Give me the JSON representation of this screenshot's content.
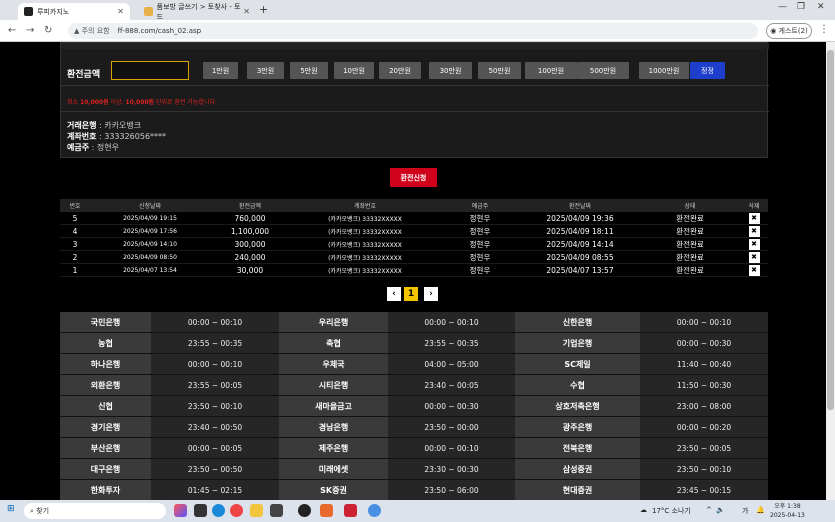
{
  "browser": {
    "tabs": [
      {
        "title": "루피카지노",
        "active": true
      },
      {
        "title": "품보방 글쓰기 > 토찾사 - 토드",
        "active": false
      }
    ],
    "security_label": "주의 요함",
    "url": "ff-888.com/cash_02.asp",
    "guest_label": "게스트(2)"
  },
  "exchange": {
    "amount_label": "환전금액",
    "amount_value": "",
    "amount_buttons": [
      "1만원",
      "3만원",
      "5만원",
      "10만원",
      "20만원",
      "30만원",
      "50만원",
      "100만원",
      "500만원",
      "1000만원"
    ],
    "reset_label": "정정",
    "notice_prefix": "최소 ",
    "notice_min": "10,000원",
    "notice_mid": " 이상, ",
    "notice_unit": "10,000원",
    "notice_suffix": " 단위로 환전 가능합니다.",
    "bank_label": "거래은행",
    "bank_value": "카카오뱅크",
    "account_label": "계좌번호",
    "account_value": "333326056****",
    "holder_label": "예금주",
    "holder_value": "정현우",
    "apply_label": "환전신청"
  },
  "history": {
    "headers": [
      "번호",
      "신청날짜",
      "환전금액",
      "계좌번호",
      "예금주",
      "환전날짜",
      "상태",
      "삭제"
    ],
    "rows": [
      {
        "no": "5",
        "req": "2025/04/09 19:15",
        "amount": "760,000",
        "account": "(카카오뱅크) 33332XXXXX",
        "holder": "정현우",
        "done": "2025/04/09 19:36",
        "status": "환전완료"
      },
      {
        "no": "4",
        "req": "2025/04/09 17:56",
        "amount": "1,100,000",
        "account": "(카카오뱅크) 33332XXXXX",
        "holder": "정현우",
        "done": "2025/04/09 18:11",
        "status": "환전완료"
      },
      {
        "no": "3",
        "req": "2025/04/09 14:10",
        "amount": "300,000",
        "account": "(카카오뱅크) 33332XXXXX",
        "holder": "정현우",
        "done": "2025/04/09 14:14",
        "status": "환전완료"
      },
      {
        "no": "2",
        "req": "2025/04/09 08:50",
        "amount": "240,000",
        "account": "(카카오뱅크) 33332XXXXX",
        "holder": "정현우",
        "done": "2025/04/09 08:55",
        "status": "환전완료"
      },
      {
        "no": "1",
        "req": "2025/04/07 13:54",
        "amount": "30,000",
        "account": "(카카오뱅크) 33332XXXXX",
        "holder": "정현우",
        "done": "2025/04/07 13:57",
        "status": "환전완료"
      }
    ],
    "page": "1"
  },
  "banks": [
    [
      {
        "name": "국민은행",
        "time": "00:00 ~ 00:10"
      },
      {
        "name": "우리은행",
        "time": "00:00 ~ 00:10"
      },
      {
        "name": "신한은행",
        "time": "00:00 ~ 00:10"
      }
    ],
    [
      {
        "name": "농협",
        "time": "23:55 ~ 00:35"
      },
      {
        "name": "축협",
        "time": "23:55 ~ 00:35"
      },
      {
        "name": "기업은행",
        "time": "00:00 ~ 00:30"
      }
    ],
    [
      {
        "name": "하나은행",
        "time": "00:00 ~ 00:10"
      },
      {
        "name": "우체국",
        "time": "04:00 ~ 05:00"
      },
      {
        "name": "SC제일",
        "time": "11:40 ~ 00:40"
      }
    ],
    [
      {
        "name": "외환은행",
        "time": "23:55 ~ 00:05"
      },
      {
        "name": "시티은행",
        "time": "23:40 ~ 00:05"
      },
      {
        "name": "수협",
        "time": "11:50 ~ 00:30"
      }
    ],
    [
      {
        "name": "신협",
        "time": "23:50 ~ 00:10"
      },
      {
        "name": "새마을금고",
        "time": "00:00 ~ 00:30"
      },
      {
        "name": "상호저축은행",
        "time": "23:00 ~ 08:00"
      }
    ],
    [
      {
        "name": "경기은행",
        "time": "23:40 ~ 00:50"
      },
      {
        "name": "경남은행",
        "time": "23:50 ~ 00:00"
      },
      {
        "name": "광주은행",
        "time": "00:00 ~ 00:20"
      }
    ],
    [
      {
        "name": "부산은행",
        "time": "00:00 ~ 00:05"
      },
      {
        "name": "제주은행",
        "time": "00:00 ~ 00:10"
      },
      {
        "name": "전북은행",
        "time": "23:50 ~ 00:05"
      }
    ],
    [
      {
        "name": "대구은행",
        "time": "23:50 ~ 00:50"
      },
      {
        "name": "미래에셋",
        "time": "23:30 ~ 00:30"
      },
      {
        "name": "삼성증권",
        "time": "23:50 ~ 00:10"
      }
    ],
    [
      {
        "name": "한화투자",
        "time": "01:45 ~ 02:15"
      },
      {
        "name": "SK증권",
        "time": "23:50 ~ 06:00"
      },
      {
        "name": "현대증권",
        "time": "23:45 ~ 00:15"
      }
    ]
  ],
  "taskbar": {
    "search_label": "찾기",
    "weather": "17°C 소나기",
    "ime": "가",
    "time": "오후 1:38",
    "date": "2025-04-13"
  }
}
